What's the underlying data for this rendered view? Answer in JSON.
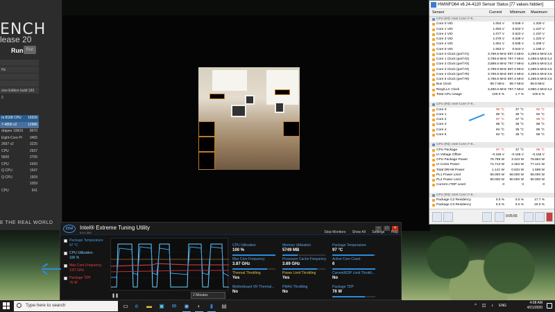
{
  "cinebench": {
    "title": "ENCH",
    "subtitle": "lease 20",
    "run_label": "Run",
    "run_button": "Run",
    "panel": [
      "",
      "Hz",
      "",
      "",
      "vice Edition build 183",
      "2"
    ],
    "ranking": [
      {
        "name": "m 8168 CPU",
        "value": "16536",
        "style": "hl"
      },
      {
        "name": "7-4890 v2",
        "value": "12986",
        "style": "hl2"
      },
      {
        "name": "dripper 1950X",
        "value": "8670",
        "style": ""
      },
      {
        "name": "Eight-Core Pr",
        "value": "3455",
        "style": ""
      },
      {
        "name": "2697 v2",
        "value": "3225",
        "style": ""
      },
      {
        "name": "CPU",
        "value": "2937",
        "style": ""
      },
      {
        "name": "5600",
        "value": "2705",
        "style": ""
      },
      {
        "name": "CPU",
        "value": "2420",
        "style": ""
      },
      {
        "name": "Q CPU",
        "value": "1647",
        "style": ""
      },
      {
        "name": "Q CPU",
        "value": "1509",
        "style": ""
      },
      {
        "name": "",
        "value": "1059",
        "style": ""
      },
      {
        "name": "CPU",
        "value": "541",
        "style": ""
      }
    ],
    "footer": "E THE REAL WORLD"
  },
  "hwinfo": {
    "title": "HWiNFO64 v6.24-4120 Sensor Status [77 values hidden]",
    "columns": {
      "sensor": "Sensor",
      "current": "Current",
      "minimum": "Minimum",
      "maximum": "Maximum"
    },
    "rows": [
      {
        "n": "CPU [#0]: Intel Core i7-9...",
        "c": "",
        "mi": "",
        "ma": "",
        "av": "",
        "t": "grp"
      },
      {
        "n": "Core 0 VID",
        "c": "1.054 V",
        "mi": "0.538 V",
        "ma": "1.200 V",
        "av": "",
        "t": ""
      },
      {
        "n": "Core 1 VID",
        "c": "1.053 V",
        "mi": "0.533 V",
        "ma": "1.237 V",
        "av": "",
        "t": ""
      },
      {
        "n": "Core 2 VID",
        "c": "1.077 V",
        "mi": "0.523 V",
        "ma": "1.197 V",
        "av": "",
        "t": ""
      },
      {
        "n": "Core 3 VID",
        "c": "1.078 V",
        "mi": "0.538 V",
        "ma": "1.220 V",
        "av": "",
        "t": ""
      },
      {
        "n": "Core 4 VID",
        "c": "1.061 V",
        "mi": "0.538 V",
        "ma": "1.209 V",
        "av": "",
        "t": ""
      },
      {
        "n": "Core 5 VID",
        "c": "1.053 V",
        "mi": "0.543 V",
        "ma": "1.195 V",
        "av": "",
        "t": ""
      },
      {
        "n": "Core 0 Clock (perf #1)",
        "c": "3,789.8 MHz",
        "mi": "897.4 MHz",
        "ma": "4,289.5 MHz",
        "av": "3,5",
        "t": ""
      },
      {
        "n": "Core 1 Clock (perf #2)",
        "c": "3,789.8 MHz",
        "mi": "797.7 MHz",
        "ma": "4,289.5 MHz",
        "av": "3,4",
        "t": ""
      },
      {
        "n": "Core 2 Clock (perf #3)",
        "c": "3,889.5 MHz",
        "mi": "797.7 MHz",
        "ma": "4,289.5 MHz",
        "av": "3,4",
        "t": ""
      },
      {
        "n": "Core 3 Clock (perf #4)",
        "c": "3,789.8 MHz",
        "mi": "897.4 MHz",
        "ma": "4,289.5 MHz",
        "av": "3,5",
        "t": ""
      },
      {
        "n": "Core 4 Clock (perf #5)",
        "c": "3,789.8 MHz",
        "mi": "897.4 MHz",
        "ma": "4,289.5 MHz",
        "av": "3,5",
        "t": ""
      },
      {
        "n": "Core 5 Clock (perf #6)",
        "c": "3,789.8 MHz",
        "mi": "897.4 MHz",
        "ma": "4,289.5 MHz",
        "av": "3,5",
        "t": ""
      },
      {
        "n": "Bus Clock",
        "c": "99.7 MHz",
        "mi": "99.7 MHz",
        "ma": "99.8 MHz",
        "av": "",
        "t": ""
      },
      {
        "n": "Ring/LLC Clock",
        "c": "3,490.6 MHz",
        "mi": "797.7 MHz",
        "ma": "3,990.2 MHz",
        "av": "3,2",
        "t": ""
      },
      {
        "n": "Total CPU Usage",
        "c": "100.0 %",
        "mi": "1.7 %",
        "ma": "100.0 %",
        "av": "",
        "t": ""
      },
      {
        "n": "",
        "c": "",
        "mi": "",
        "ma": "",
        "av": "",
        "t": "blank"
      },
      {
        "n": "CPU [#0]: Intel Core i7-9...",
        "c": "",
        "mi": "",
        "ma": "",
        "av": "",
        "t": "grp"
      },
      {
        "n": "Core 0",
        "c": "90 °C",
        "mi": "37 °C",
        "ma": "92 °C",
        "av": "",
        "t": "red"
      },
      {
        "n": "Core 1",
        "c": "80 °C",
        "mi": "35 °C",
        "ma": "82 °C",
        "av": "",
        "t": ""
      },
      {
        "n": "Core 2",
        "c": "97 °C",
        "mi": "37 °C",
        "ma": "98 °C",
        "av": "",
        "t": "red"
      },
      {
        "n": "Core 3",
        "c": "86 °C",
        "mi": "36 °C",
        "ma": "88 °C",
        "av": "",
        "t": ""
      },
      {
        "n": "Core 4",
        "c": "84 °C",
        "mi": "35 °C",
        "ma": "86 °C",
        "av": "",
        "t": ""
      },
      {
        "n": "Core 5",
        "c": "84 °C",
        "mi": "35 °C",
        "ma": "86 °C",
        "av": "",
        "t": ""
      },
      {
        "n": "",
        "c": "",
        "mi": "",
        "ma": "",
        "av": "",
        "t": "blank"
      },
      {
        "n": "CPU [#0]: Intel Core i7-9...",
        "c": "",
        "mi": "",
        "ma": "",
        "av": "",
        "t": "grp"
      },
      {
        "n": "CPU Package",
        "c": "97 °C",
        "mi": "37 °C",
        "ma": "98 °C",
        "av": "",
        "t": "red"
      },
      {
        "n": "IA Voltage Offset",
        "c": "-0.155 V",
        "mi": "-0.155 V",
        "ma": "-0.155 V",
        "av": "",
        "t": ""
      },
      {
        "n": "CPU Package Power",
        "c": "76.788 W",
        "mi": "3.443 W",
        "ma": "78.884 W",
        "av": "",
        "t": ""
      },
      {
        "n": "IA Cores Power",
        "c": "74.713 W",
        "mi": "2.463 W",
        "ma": "77.121 W",
        "av": "",
        "t": ""
      },
      {
        "n": "Total DRAM Power",
        "c": "1.141 W",
        "mi": "0.634 W",
        "ma": "1.598 W",
        "av": "",
        "t": ""
      },
      {
        "n": "PL1 Power Limit",
        "c": "66.000 W",
        "mi": "66.000 W",
        "ma": "66.000 W",
        "av": "",
        "t": ""
      },
      {
        "n": "PL2 Power Limit",
        "c": "90.000 W",
        "mi": "90.000 W",
        "ma": "90.000 W",
        "av": "",
        "t": ""
      },
      {
        "n": "Current cTDP Level",
        "c": "0",
        "mi": "0",
        "ma": "0",
        "av": "",
        "t": ""
      },
      {
        "n": "",
        "c": "",
        "mi": "",
        "ma": "",
        "av": "",
        "t": "blank"
      },
      {
        "n": "CPU [#0]: Intel Core i7-9...",
        "c": "",
        "mi": "",
        "ma": "",
        "av": "",
        "t": "grp"
      },
      {
        "n": "Package C2 Residency",
        "c": "0.0 %",
        "mi": "0.0 %",
        "ma": "17.7 %",
        "av": "",
        "t": ""
      },
      {
        "n": "Package C3 Residency",
        "c": "0.0 %",
        "mi": "0.0 %",
        "ma": "20.0 %",
        "av": "",
        "t": ""
      }
    ],
    "elapsed": "0:05:55"
  },
  "xtu": {
    "logo": "intel",
    "title": "Intel® Extreme Tuning Utility",
    "version": "6.5.1.360",
    "actions": {
      "stop": "Stop Monitors",
      "show_all": "Show All",
      "settings": "Settings",
      "help": "Help"
    },
    "metrics": [
      {
        "label": "Package Temperature",
        "value": "97 °C",
        "color": "#3aa0e8"
      },
      {
        "label": "CPU Utilization",
        "value": "100 %",
        "color": "#6fd3ff"
      },
      {
        "label": "Max Core Frequency",
        "value": "3.87 GHz",
        "color": "#e84040"
      },
      {
        "label": "Package TDP",
        "value": "76 W",
        "color": "#e84040"
      }
    ],
    "duration": "2 Minutes",
    "stats": [
      {
        "label": "CPU Utilization",
        "value": "100 %",
        "level": 1.0,
        "warn": false
      },
      {
        "label": "Memory Utilization",
        "value": "5749 MB",
        "level": 0.35,
        "warn": false
      },
      {
        "label": "Package Temperature",
        "value": "97 °C",
        "level": 0.97,
        "warn": false
      },
      {
        "label": "Max Core Frequency",
        "value": "3.87 GHz",
        "level": 0.8,
        "warn": false
      },
      {
        "label": "Processor Cache Frequency",
        "value": "3.69 GHz",
        "level": 0.8,
        "warn": false
      },
      {
        "label": "Active Core Count",
        "value": "6",
        "level": 1.0,
        "warn": false
      },
      {
        "label": "Thermal Throttling",
        "value": "Yes",
        "level": 0,
        "warn": true
      },
      {
        "label": "Power Limit Throttling",
        "value": "Yes",
        "level": 0,
        "warn": true
      },
      {
        "label": "Current/EDP Limit Throttli...",
        "value": "No",
        "level": 0,
        "warn": false
      },
      {
        "label": "Motherboard VR Thermal...",
        "value": "No",
        "level": 0,
        "warn": false
      },
      {
        "label": "PMAX Throttling",
        "value": "No",
        "level": 0,
        "warn": false
      },
      {
        "label": "Package TDP",
        "value": "76 W",
        "level": 0.75,
        "warn": false
      }
    ]
  },
  "taskbar": {
    "search_placeholder": "Type here to search",
    "language": "ENG",
    "time": "4:08 AM",
    "date": "4/21/2020",
    "tray_icons": "^ ◫ ♪"
  }
}
